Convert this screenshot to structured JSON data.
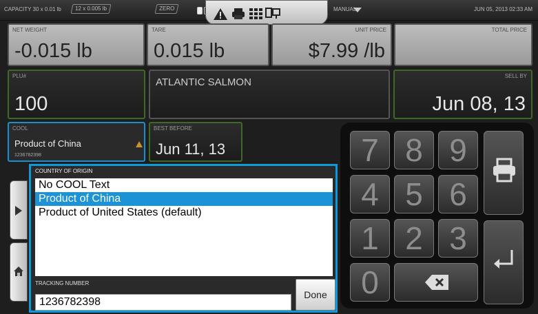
{
  "topbar": {
    "capacity": "CAPACITY  30 x 0.01 lb",
    "range": "12 x 0.005 lb",
    "zero": "ZERO",
    "mode": "MANUAL",
    "datetime": "JUN 05, 2013 02:33 AM"
  },
  "net_weight": {
    "label": "NET WEIGHT",
    "value": "-0.015 lb"
  },
  "tare": {
    "label": "TARE",
    "value": "0.015 lb"
  },
  "unit_price": {
    "label": "UNIT PRICE",
    "value": "$7.99 /lb"
  },
  "total_price": {
    "label": "TOTAL PRICE",
    "value": ""
  },
  "plu": {
    "label": "PLU#",
    "value": "100"
  },
  "description": {
    "value": "ATLANTIC SALMON"
  },
  "sell_by": {
    "label": "SELL BY",
    "value": "Jun 08, 13"
  },
  "cool": {
    "label": "COOL",
    "value": "Product of China",
    "code": "1236782398"
  },
  "best_before": {
    "label": "BEST BEFORE",
    "value": "Jun 11, 13"
  },
  "keypad": {
    "keys": [
      "7",
      "8",
      "9",
      "4",
      "5",
      "6",
      "1",
      "2",
      "3",
      "0"
    ]
  },
  "popup": {
    "title": "COUNTRY OF ORIGIN",
    "options": [
      "No COOL Text",
      "Product of China",
      "Product of United States (default)"
    ],
    "selected_index": 1,
    "tracking_label": "TRACKING NUMBER",
    "tracking_value": "1236782398",
    "done_label": "Done"
  },
  "colors": {
    "accent_green": "#3e6a26",
    "accent_blue": "#0e9ad8",
    "selection": "#1c93d6"
  }
}
